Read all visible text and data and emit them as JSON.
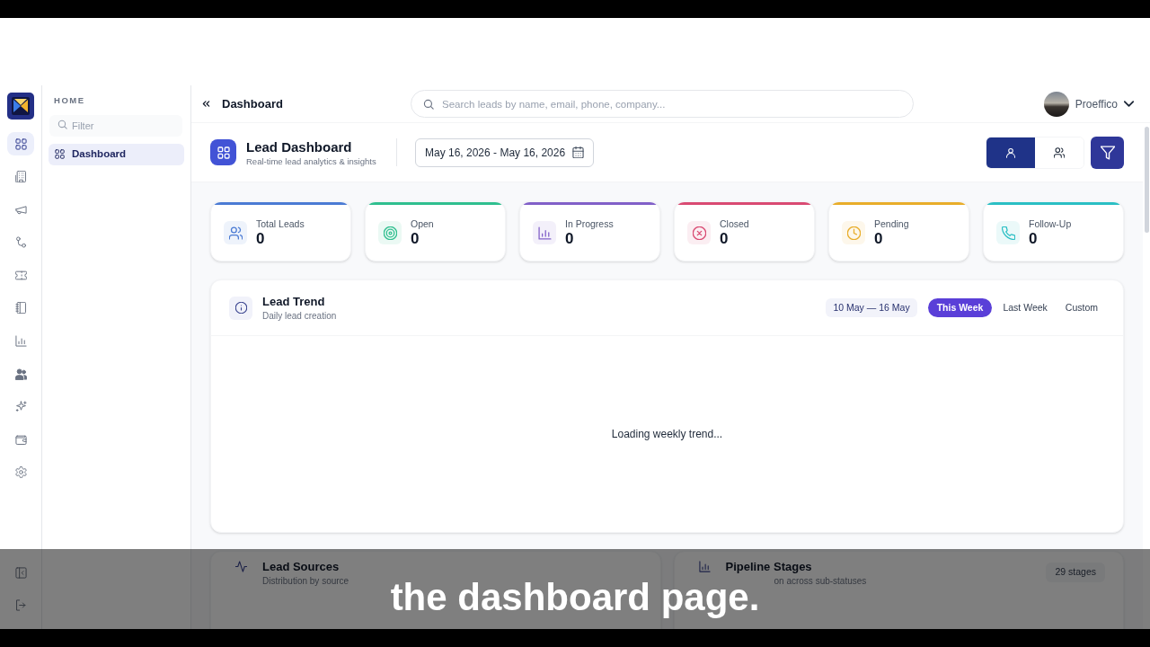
{
  "rail": [
    {
      "selected": true
    },
    {
      "selected": false
    },
    {
      "selected": false
    },
    {
      "selected": false
    },
    {
      "selected": false
    },
    {
      "selected": false
    },
    {
      "selected": false
    },
    {
      "selected": false
    },
    {
      "selected": false
    },
    {
      "selected": false
    },
    {
      "selected": false
    }
  ],
  "sidebar": {
    "section": "HOME",
    "filter": {
      "placeholder": "Filter"
    },
    "items": [
      {
        "label": "Dashboard",
        "selected": true
      }
    ]
  },
  "header": {
    "breadcrumb": "Dashboard",
    "search": {
      "placeholder": "Search leads by name, email, phone, company..."
    },
    "user": "Proeffico"
  },
  "page_header": {
    "title": "Lead Dashboard",
    "subtitle": "Real-time lead analytics & insights",
    "date_range": "May 16, 2026 - May 16, 2026",
    "view_toggle": [
      {
        "selected": true
      },
      {
        "selected": false
      }
    ]
  },
  "stats": [
    {
      "label": "Total Leads",
      "value": "0",
      "color": "#4b7bd4"
    },
    {
      "label": "Open",
      "value": "0",
      "color": "#2fbf8f"
    },
    {
      "label": "In Progress",
      "value": "0",
      "color": "#8160c8"
    },
    {
      "label": "Closed",
      "value": "0",
      "color": "#d94a72"
    },
    {
      "label": "Pending",
      "value": "0",
      "color": "#e8ad2a"
    },
    {
      "label": "Follow-Up",
      "value": "0",
      "color": "#2bbfc4"
    }
  ],
  "lead_trend": {
    "title": "Lead Trend",
    "subtitle": "Daily lead creation",
    "range": "10 May — 16 May",
    "periods": [
      {
        "label": "This Week",
        "selected": true
      },
      {
        "label": "Last Week",
        "selected": false
      },
      {
        "label": "Custom",
        "selected": false
      }
    ],
    "status": "Loading weekly trend..."
  },
  "lead_sources": {
    "title": "Lead Sources",
    "subtitle": "Distribution by source"
  },
  "pipeline_stages": {
    "title": "Pipeline Stages",
    "subtitle": "on across sub-statuses",
    "badge": "29 stages"
  },
  "caption": "the dashboard page."
}
